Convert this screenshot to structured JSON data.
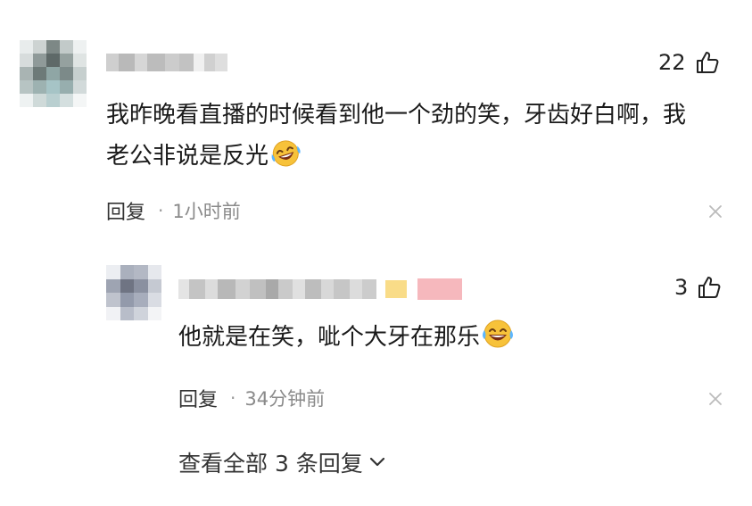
{
  "comment": {
    "author_name_visible": "",
    "likes": "22",
    "text": "我昨晚看直播的时候看到他一个劲的笑，牙齿好白啊，我",
    "text_line2": "老公非说是反光",
    "emoji": "face-with-tears-of-joy",
    "reply_label": "回复",
    "separator": "·",
    "time": "1小时前"
  },
  "reply": {
    "likes": "3",
    "text": "他就是在笑，呲个大牙在那乐",
    "emoji": "face-with-tears-of-joy",
    "reply_label": "回复",
    "separator": "·",
    "time": "34分钟前"
  },
  "view_all": {
    "label": "查看全部 3 条回复"
  },
  "colors": {
    "text_primary": "#1a1a1a",
    "text_secondary": "#8a8a8a",
    "like_icon": "#222222",
    "close_icon": "#bbbbbb",
    "badge_yellow": "#f9dc88",
    "badge_pink": "#f6b8bd"
  }
}
